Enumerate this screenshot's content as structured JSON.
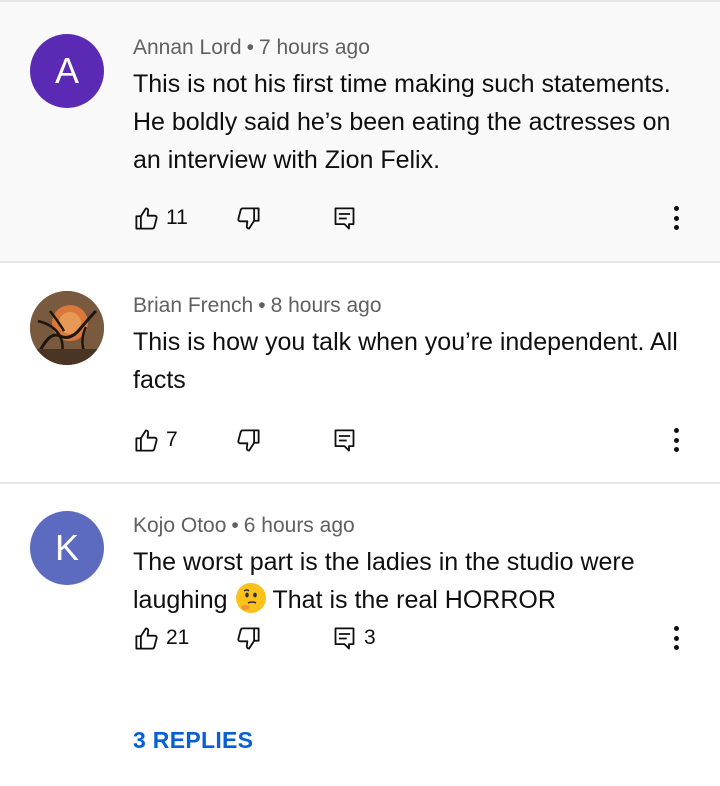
{
  "comments": [
    {
      "avatar_letter": "A",
      "avatar_color": "#5b2ab5",
      "author": "Annan Lord",
      "separator": "•",
      "time": "7 hours ago",
      "text": "This is not his first time making such statements. He boldly said he’s been eating the actresses on an interview with Zion Felix.",
      "likes": "11"
    },
    {
      "avatar_letter": "",
      "avatar_color": "#6b4a2f",
      "author": "Brian French",
      "separator": "•",
      "time": "8 hours ago",
      "text": "This is how you talk when you’re independent. All facts",
      "likes": "7"
    },
    {
      "avatar_letter": "K",
      "avatar_color": "#5c6bc0",
      "author": "Kojo Otoo",
      "separator": "•",
      "time": "6 hours ago",
      "text_before_emoji": "The worst part is the ladies in the studio were laughing",
      "emoji_name": "thinking-face-emoji",
      "text_after_emoji": "That is the real HORROR",
      "likes": "21",
      "reply_count": "3",
      "replies_link": "3 REPLIES"
    }
  ],
  "colors": {
    "link": "#065fd4",
    "meta": "#606060",
    "highlight_bg": "#f9f9f9"
  }
}
